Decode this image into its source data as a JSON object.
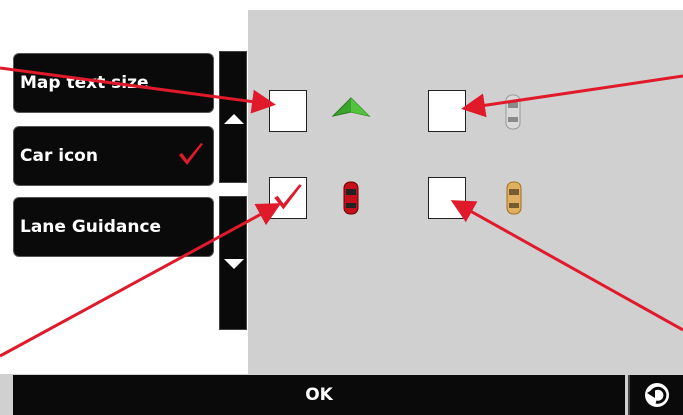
{
  "menu": {
    "items": [
      {
        "label": "Map text size",
        "checked": false
      },
      {
        "label": "Car icon",
        "checked": true
      },
      {
        "label": "Lane Guidance",
        "checked": false
      }
    ]
  },
  "options": [
    {
      "icon": "green-arrow-icon",
      "checked": false
    },
    {
      "icon": "silver-car-icon",
      "checked": false
    },
    {
      "icon": "red-car-icon",
      "checked": true
    },
    {
      "icon": "gold-car-icon",
      "checked": false
    }
  ],
  "footer": {
    "ok_label": "OK",
    "back_icon": "back-arrow-icon"
  },
  "colors": {
    "check": "#e0192b",
    "annotation": "#e0192b",
    "panel": "#d0d0d0",
    "button": "#0a0a0a"
  }
}
